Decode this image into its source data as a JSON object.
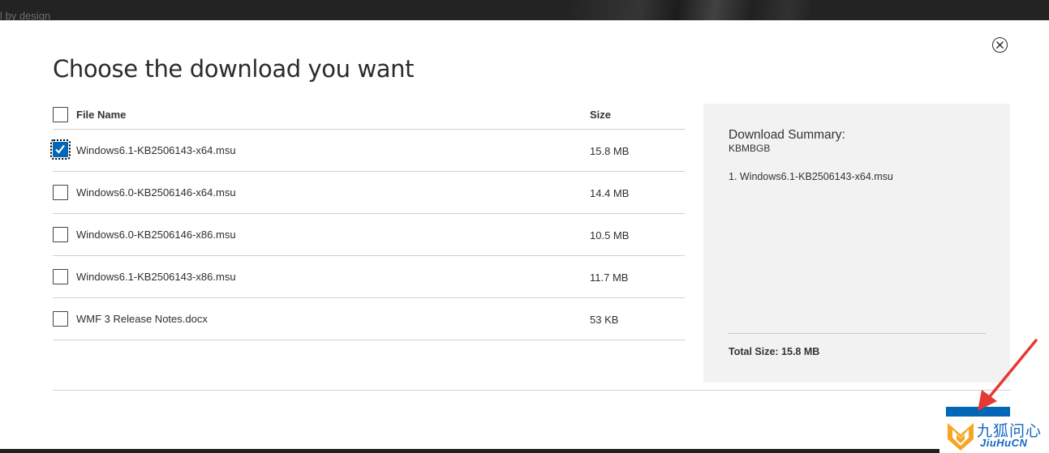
{
  "topbar": {
    "partial_text": "l by design"
  },
  "dialog": {
    "title": "Choose the download you want",
    "table": {
      "header": {
        "name": "File Name",
        "size": "Size"
      },
      "rows": [
        {
          "name": "Windows6.1-KB2506143-x64.msu",
          "size": "15.8 MB",
          "checked": true
        },
        {
          "name": "Windows6.0-KB2506146-x64.msu",
          "size": "14.4 MB",
          "checked": false
        },
        {
          "name": "Windows6.0-KB2506146-x86.msu",
          "size": "10.5 MB",
          "checked": false
        },
        {
          "name": "Windows6.1-KB2506143-x86.msu",
          "size": "11.7 MB",
          "checked": false
        },
        {
          "name": "WMF 3 Release Notes.docx",
          "size": "53 KB",
          "checked": false
        }
      ]
    },
    "summary": {
      "title": "Download Summary:",
      "subtitle": "KBMBGB",
      "items": [
        "1. Windows6.1-KB2506143-x64.msu"
      ],
      "total": "Total Size: 15.8 MB"
    }
  },
  "watermark": {
    "cn": "九狐问心",
    "en": "JiuHuCN"
  },
  "colors": {
    "accent": "#0067b8",
    "arrow": "#e53935",
    "watermark": "#1565c0",
    "watermark_logo": "#f5a623"
  }
}
